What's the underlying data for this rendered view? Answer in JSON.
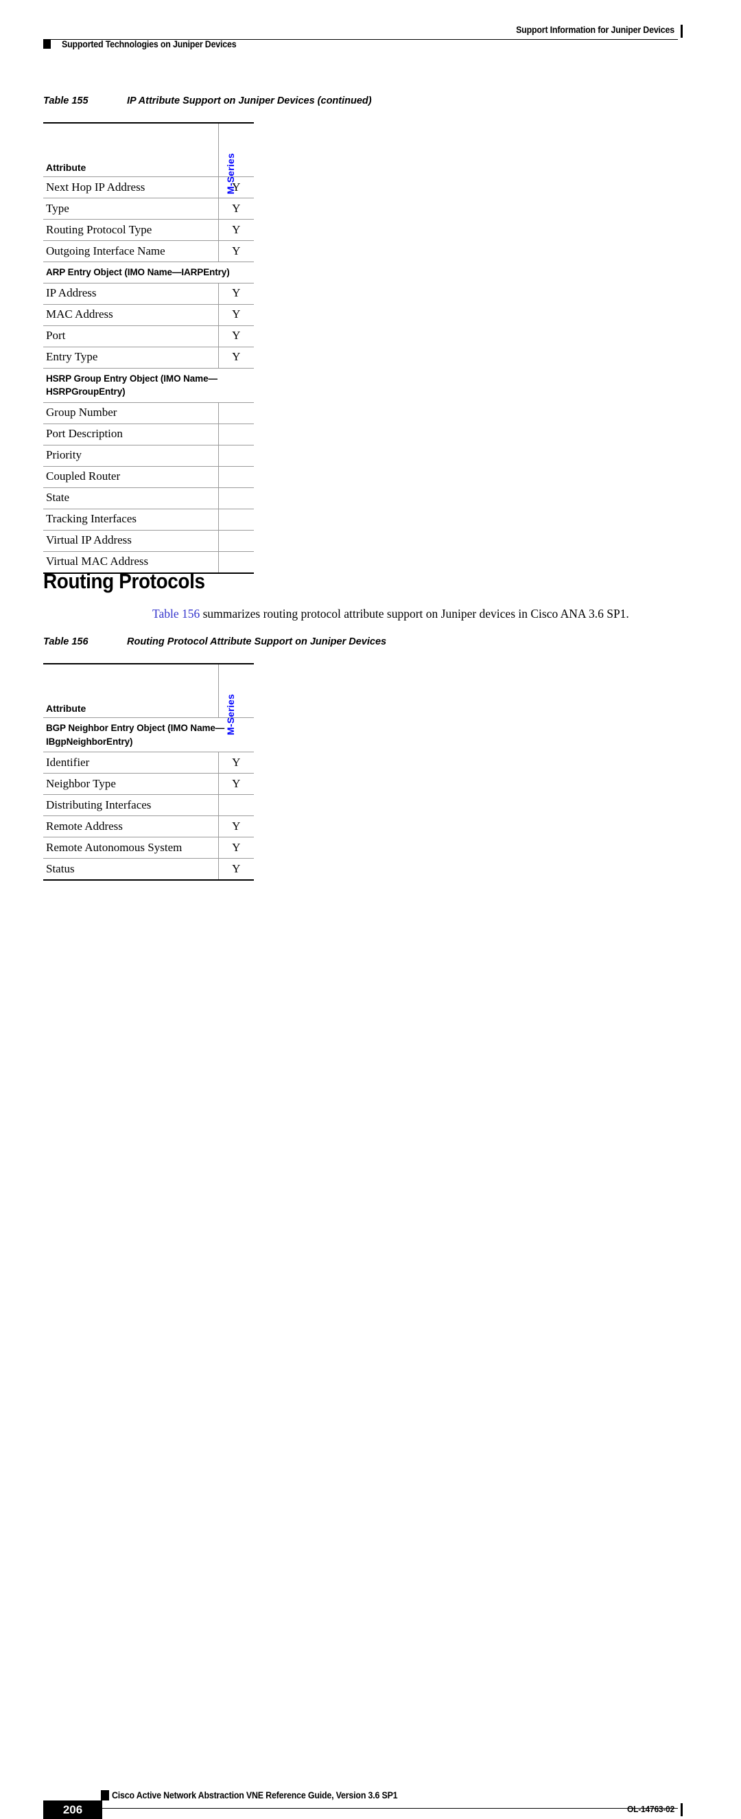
{
  "header": {
    "right_text": "Support Information for Juniper Devices",
    "left_text": "Supported Technologies on Juniper Devices"
  },
  "table155": {
    "caption_number": "Table 155",
    "caption_title": "IP Attribute Support on Juniper Devices (continued)",
    "col_attribute": "Attribute",
    "col_mseries": "M-Series",
    "rows": [
      {
        "type": "data",
        "attribute": "Next Hop IP Address",
        "mseries": "Y"
      },
      {
        "type": "data",
        "attribute": "Type",
        "mseries": "Y"
      },
      {
        "type": "data",
        "attribute": "Routing Protocol Type",
        "mseries": "Y"
      },
      {
        "type": "data",
        "attribute": "Outgoing Interface Name",
        "mseries": "Y"
      },
      {
        "type": "section",
        "attribute": "ARP Entry Object (IMO Name—IARPEntry)",
        "mseries": ""
      },
      {
        "type": "data",
        "attribute": "IP Address",
        "mseries": "Y"
      },
      {
        "type": "data",
        "attribute": "MAC Address",
        "mseries": "Y"
      },
      {
        "type": "data",
        "attribute": "Port",
        "mseries": "Y"
      },
      {
        "type": "data",
        "attribute": "Entry Type",
        "mseries": "Y"
      },
      {
        "type": "section",
        "attribute": "HSRP Group Entry Object (IMO Name—HSRPGroupEntry)",
        "mseries": ""
      },
      {
        "type": "data",
        "attribute": "Group Number",
        "mseries": ""
      },
      {
        "type": "data",
        "attribute": "Port Description",
        "mseries": ""
      },
      {
        "type": "data",
        "attribute": "Priority",
        "mseries": ""
      },
      {
        "type": "data",
        "attribute": "Coupled Router",
        "mseries": ""
      },
      {
        "type": "data",
        "attribute": "State",
        "mseries": ""
      },
      {
        "type": "data",
        "attribute": "Tracking Interfaces",
        "mseries": ""
      },
      {
        "type": "data",
        "attribute": "Virtual IP Address",
        "mseries": ""
      },
      {
        "type": "data",
        "attribute": "Virtual MAC Address",
        "mseries": ""
      }
    ]
  },
  "section": {
    "heading": "Routing Protocols",
    "paragraph_link": "Table 156",
    "paragraph_text": " summarizes routing protocol attribute support on Juniper devices in Cisco ANA 3.6 SP1."
  },
  "table156": {
    "caption_number": "Table 156",
    "caption_title": "Routing Protocol Attribute Support on Juniper Devices",
    "col_attribute": "Attribute",
    "col_mseries": "M-Series",
    "rows": [
      {
        "type": "section",
        "attribute": "BGP Neighbor Entry Object (IMO Name—IBgpNeighborEntry)",
        "mseries": ""
      },
      {
        "type": "data",
        "attribute": "Identifier",
        "mseries": "Y"
      },
      {
        "type": "data",
        "attribute": "Neighbor Type",
        "mseries": "Y"
      },
      {
        "type": "data",
        "attribute": "Distributing Interfaces",
        "mseries": ""
      },
      {
        "type": "data",
        "attribute": "Remote Address",
        "mseries": "Y"
      },
      {
        "type": "data",
        "attribute": "Remote Autonomous System",
        "mseries": "Y"
      },
      {
        "type": "data",
        "attribute": "Status",
        "mseries": "Y"
      }
    ]
  },
  "footer": {
    "guide_title": "Cisco Active Network Abstraction VNE Reference Guide, Version 3.6 SP1",
    "page_number": "206",
    "doc_id": "OL-14763-02"
  },
  "colors": {
    "link": "#3333cc",
    "vertical_header": "#0000ff",
    "rule": "#000000"
  }
}
